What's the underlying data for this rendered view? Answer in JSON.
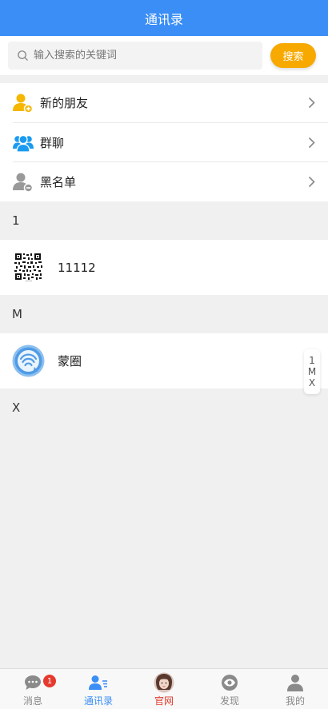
{
  "header": {
    "title": "通讯录"
  },
  "search": {
    "placeholder": "输入搜索的关键词",
    "button_label": "搜索"
  },
  "menu": {
    "items": [
      {
        "label": "新的朋友",
        "icon": "add-friend-icon",
        "color": "#f5b700"
      },
      {
        "label": "群聊",
        "icon": "group-chat-icon",
        "color": "#1a9bf0"
      },
      {
        "label": "黑名单",
        "icon": "blacklist-icon",
        "color": "#999999"
      }
    ]
  },
  "sections": [
    {
      "letter": "1",
      "contacts": [
        {
          "name": "11112",
          "avatar": "qr-code-avatar"
        }
      ]
    },
    {
      "letter": "M",
      "contacts": [
        {
          "name": "蒙圈",
          "avatar": "wifi-logo-avatar"
        }
      ]
    },
    {
      "letter": "X",
      "contacts": []
    }
  ],
  "index_bar": [
    "1",
    "M",
    "X"
  ],
  "tabbar": {
    "active": "通讯录",
    "tabs": [
      {
        "label": "消息",
        "icon": "chat-bubble-icon",
        "badge": "1"
      },
      {
        "label": "通讯录",
        "icon": "contacts-icon"
      },
      {
        "label": "官网",
        "icon": "website-avatar-icon"
      },
      {
        "label": "发现",
        "icon": "eye-icon"
      },
      {
        "label": "我的",
        "icon": "profile-icon"
      }
    ]
  },
  "colors": {
    "primary": "#3a8ef6",
    "accent": "#f7a900",
    "badge": "#e63a2e",
    "home_label": "#e03a2c"
  }
}
